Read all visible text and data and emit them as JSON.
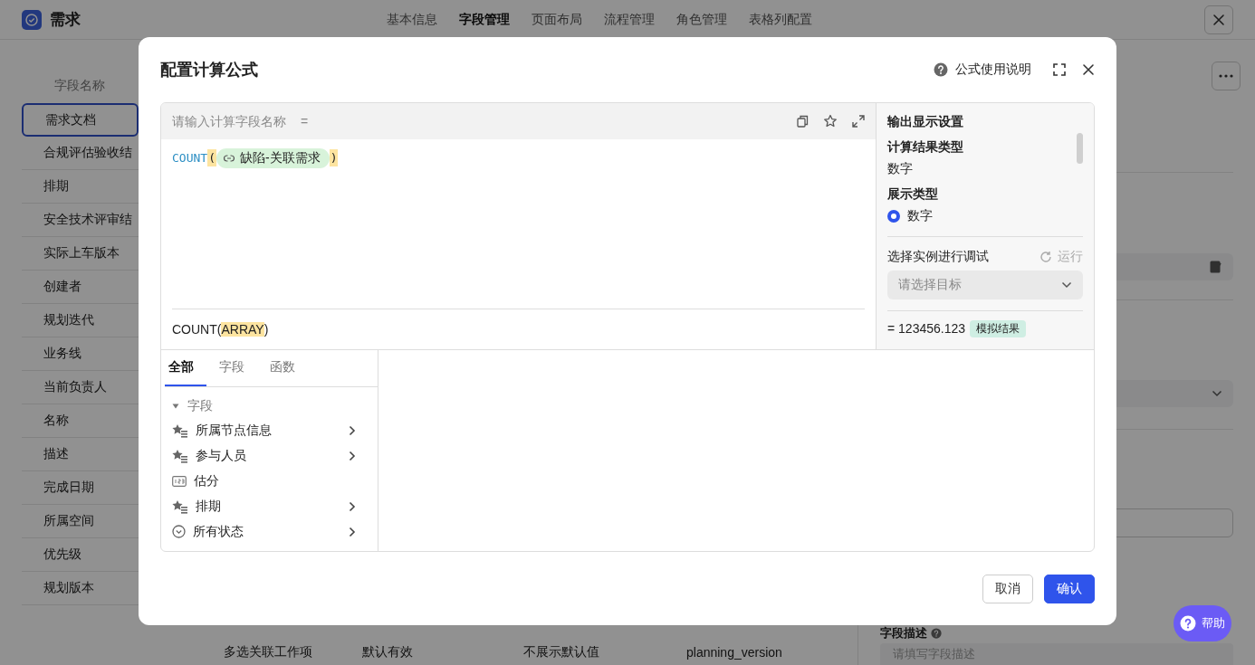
{
  "app": {
    "title": "需求"
  },
  "nav_tabs": [
    {
      "label": "基本信息",
      "selected": false
    },
    {
      "label": "字段管理",
      "selected": true
    },
    {
      "label": "页面布局",
      "selected": false
    },
    {
      "label": "流程管理",
      "selected": false
    },
    {
      "label": "角色管理",
      "selected": false
    },
    {
      "label": "表格列配置",
      "selected": false
    }
  ],
  "field_list": {
    "heading": "字段名称",
    "items": [
      {
        "label": "需求文档",
        "selected": true
      },
      {
        "label": "合规评估验收结",
        "selected": false
      },
      {
        "label": "排期",
        "selected": false
      },
      {
        "label": "安全技术评审结",
        "selected": false
      },
      {
        "label": "实际上车版本",
        "selected": false
      },
      {
        "label": "创建者",
        "selected": false
      },
      {
        "label": "规划迭代",
        "selected": false
      },
      {
        "label": "业务线",
        "selected": false
      },
      {
        "label": "当前负责人",
        "selected": false
      },
      {
        "label": "名称",
        "selected": false
      },
      {
        "label": "描述",
        "selected": false
      },
      {
        "label": "完成日期",
        "selected": false
      },
      {
        "label": "所属空间",
        "selected": false
      },
      {
        "label": "优先级",
        "selected": false
      },
      {
        "label": "规划版本",
        "selected": false
      }
    ]
  },
  "table_row": [
    "多选关联工作项",
    "默认有效",
    "不展示默认值",
    "planning_version"
  ],
  "description_field": {
    "label": "字段描述",
    "placeholder": "请填写字段描述"
  },
  "dialog": {
    "title": "配置计算公式",
    "help_link": "公式使用说明",
    "name_field": {
      "placeholder": "请输入计算字段名称",
      "suffix": "="
    },
    "formula": {
      "function": "COUNT",
      "open": "(",
      "field": "缺陷-关联需求",
      "close": ")"
    },
    "signature": {
      "function": "COUNT",
      "open": "(",
      "argument": "ARRAY",
      "close": ")"
    },
    "output_settings": {
      "title": "输出显示设置",
      "result_type_label": "计算结果类型",
      "result_type": "数字",
      "display_type_label": "展示类型",
      "display_options": [
        {
          "label": "数字",
          "selected": true
        }
      ]
    },
    "debug": {
      "title": "选择实例进行调试",
      "run_button": {
        "label": "运行",
        "disabled": true
      },
      "target_select": {
        "placeholder": "请选择目标"
      },
      "result": "= 123456.123",
      "result_badge": "模拟结果"
    },
    "picker_tabs": [
      {
        "label": "全部",
        "selected": true
      },
      {
        "label": "字段",
        "selected": false
      },
      {
        "label": "函数",
        "selected": false
      }
    ],
    "tree": [
      {
        "label": "字段",
        "expanded": true,
        "children": [
          {
            "label": "所属节点信息",
            "kind": "relation",
            "has_submenu": true
          },
          {
            "label": "参与人员",
            "kind": "relation",
            "has_submenu": true
          },
          {
            "label": "估分",
            "kind": "number",
            "has_submenu": false
          },
          {
            "label": "排期",
            "kind": "relation",
            "has_submenu": true
          },
          {
            "label": "所有状态",
            "kind": "status",
            "has_submenu": true
          }
        ]
      }
    ],
    "buttons": [
      {
        "label": "取消",
        "kind": "secondary"
      },
      {
        "label": "确认",
        "kind": "primary"
      }
    ]
  },
  "help_button": {
    "label": "帮助"
  }
}
